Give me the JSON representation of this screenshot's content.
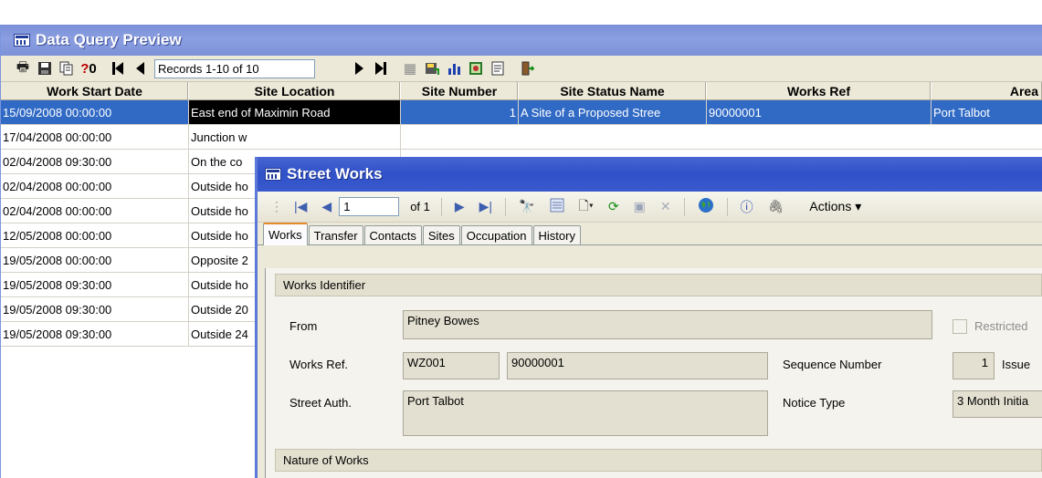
{
  "dqp": {
    "title": "Data Query Preview",
    "toolbar": {
      "records_value": "Records 1-10 of 10"
    },
    "columns": [
      "Work Start Date",
      "Site Location",
      "Site Number",
      "Site Status Name",
      "Works Ref",
      "Area"
    ],
    "rows": [
      {
        "date": "15/09/2008 00:00:00",
        "location": "East end of Maximin Road",
        "number": "1",
        "status": "A Site of a Proposed Stree",
        "ref": "90000001",
        "area": "Port Talbot"
      },
      {
        "date": "17/04/2008 00:00:00",
        "location": "Junction w"
      },
      {
        "date": "02/04/2008 09:30:00",
        "location": "On the co"
      },
      {
        "date": "02/04/2008 00:00:00",
        "location": "Outside ho"
      },
      {
        "date": "02/04/2008 00:00:00",
        "location": "Outside ho"
      },
      {
        "date": "12/05/2008 00:00:00",
        "location": "Outside ho"
      },
      {
        "date": "19/05/2008 00:00:00",
        "location": "Opposite 2"
      },
      {
        "date": "19/05/2008 09:30:00",
        "location": "Outside ho"
      },
      {
        "date": "19/05/2008 09:30:00",
        "location": "Outside 20"
      },
      {
        "date": "19/05/2008 09:30:00",
        "location": "Outside 24"
      }
    ]
  },
  "sw": {
    "title": "Street Works",
    "toolbar": {
      "position_value": "1",
      "of_label": "of 1",
      "actions_label": "Actions ▾"
    },
    "tabs": [
      "Works",
      "Transfer",
      "Contacts",
      "Sites",
      "Occupation",
      "History"
    ],
    "works_identifier": {
      "section_title": "Works Identifier",
      "from_label": "From",
      "from_value": "Pitney Bowes",
      "restricted_label": "Restricted",
      "works_ref_label": "Works Ref.",
      "works_ref_prefix": "WZ001",
      "works_ref_number": "90000001",
      "sequence_label": "Sequence Number",
      "sequence_value": "1",
      "issue_label": "Issue",
      "street_auth_label": "Street Auth.",
      "street_auth_value": "Port Talbot",
      "notice_type_label": "Notice Type",
      "notice_type_value": "3 Month Initia"
    },
    "nature_section_title": "Nature of Works"
  }
}
